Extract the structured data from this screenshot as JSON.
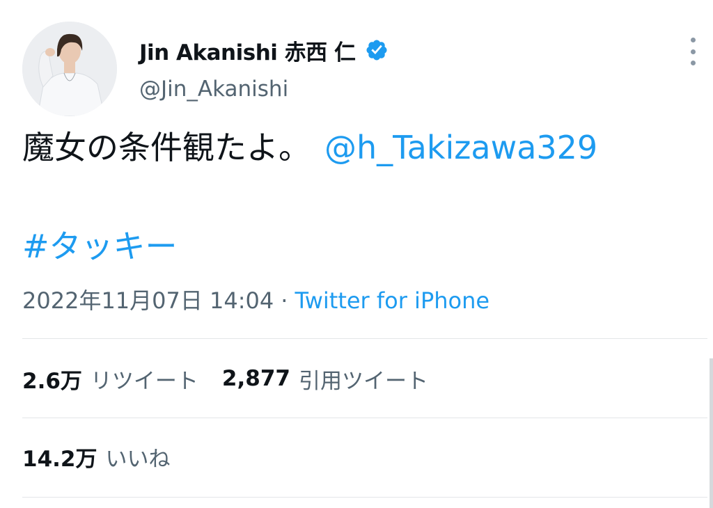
{
  "tweet": {
    "author": {
      "display_name": "Jin Akanishi  赤西 仁",
      "handle": "@Jin_Akanishi",
      "verified": true,
      "avatar_icon": "user-avatar-photo"
    },
    "menu_icon": "more-vertical-icon",
    "text": {
      "line1": "魔女の条件観たよ。",
      "mention": "@h_Takizawa329",
      "hashtag": "#タッキー"
    },
    "meta": {
      "timestamp": "2022年11月07日 14:04",
      "separator": "·",
      "source": "Twitter for iPhone"
    },
    "stats": {
      "retweets_count": "2.6万",
      "retweets_label": "リツイート",
      "quotes_count": "2,877",
      "quotes_label": "引用ツイート",
      "likes_count": "14.2万",
      "likes_label": "いいね"
    }
  },
  "colors": {
    "accent": "#1d9bf0",
    "text_primary": "#0f1419",
    "text_secondary": "#536471",
    "divider": "#e3e6e8"
  }
}
